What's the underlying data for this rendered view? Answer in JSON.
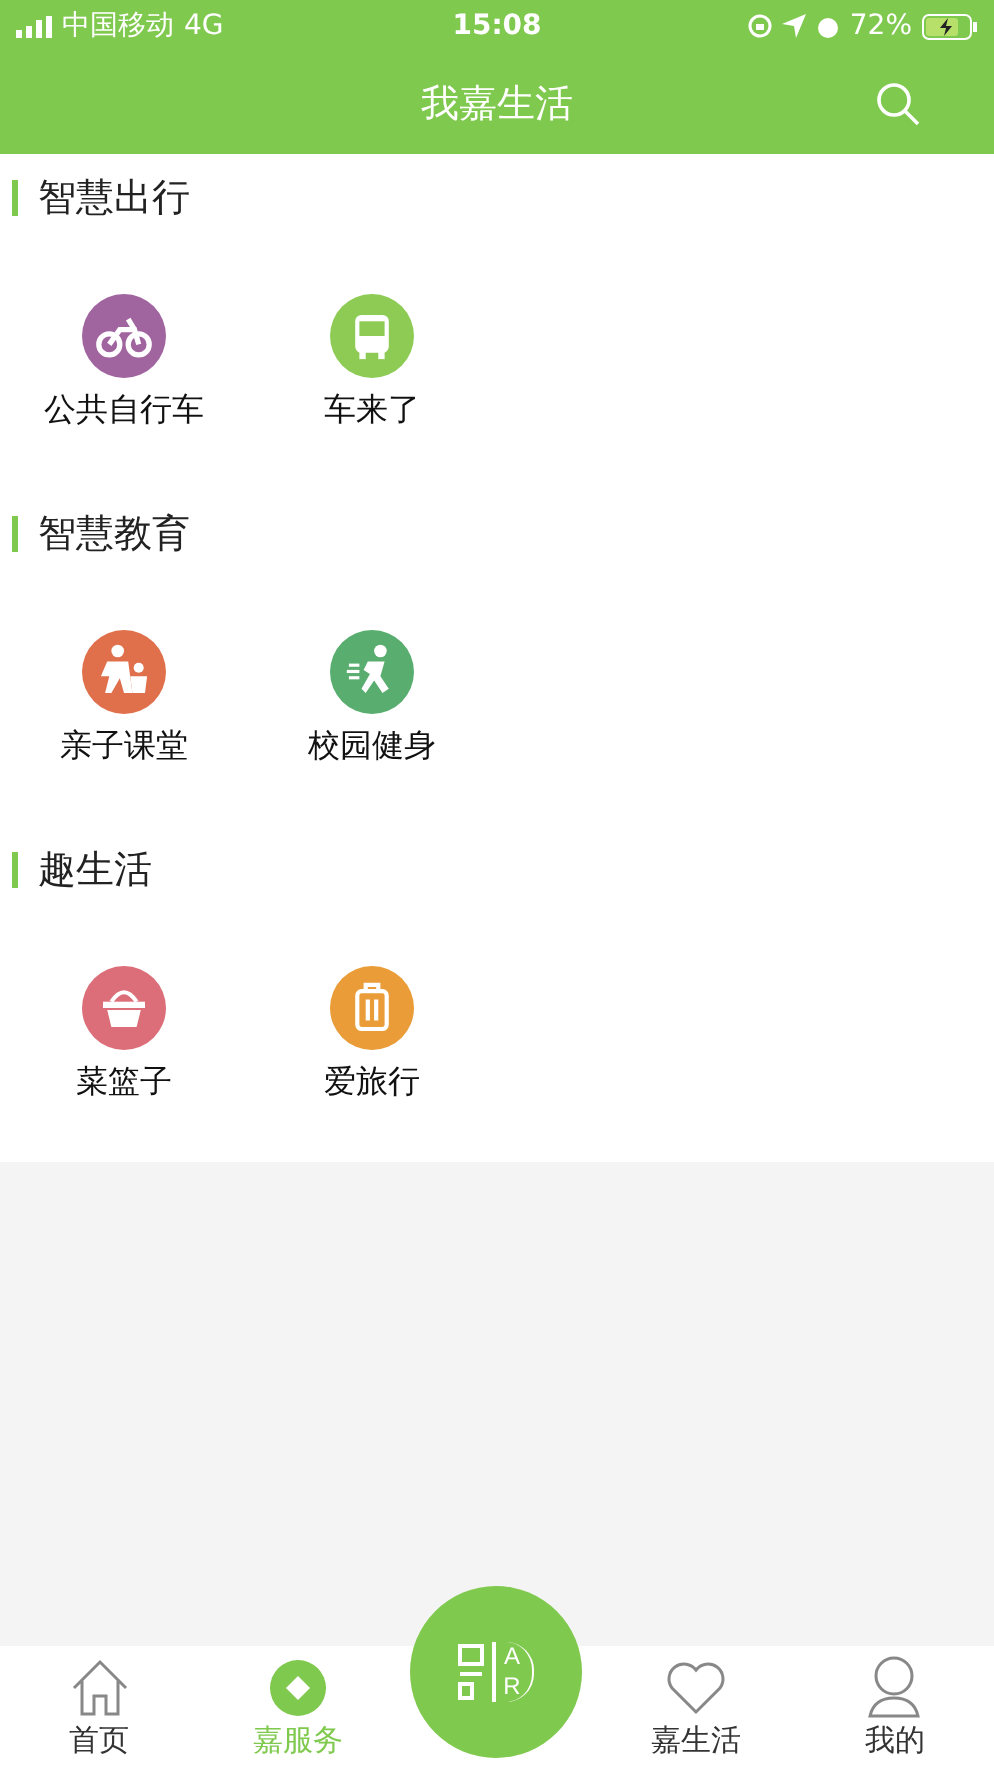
{
  "status_bar": {
    "carrier": "中国移动",
    "network": "4G",
    "time": "15:08",
    "battery": "72%"
  },
  "header": {
    "title": "我嘉生活"
  },
  "sections": [
    {
      "title": "智慧出行",
      "items": [
        {
          "label": "公共自行车",
          "kind": "bike",
          "color": "#a0649f"
        },
        {
          "label": "车来了",
          "kind": "bus",
          "color": "#8dcb55"
        }
      ]
    },
    {
      "title": "智慧教育",
      "items": [
        {
          "label": "亲子课堂",
          "kind": "family",
          "color": "#e0704c"
        },
        {
          "label": "校园健身",
          "kind": "runner",
          "color": "#58ad6f"
        }
      ]
    },
    {
      "title": "趣生活",
      "items": [
        {
          "label": "菜篮子",
          "kind": "basket",
          "color": "#dc6e79"
        },
        {
          "label": "爱旅行",
          "kind": "luggage",
          "color": "#e99c37"
        }
      ]
    }
  ],
  "ar_button": {
    "letters": [
      "A",
      "R"
    ]
  },
  "tabs": [
    {
      "label": "首页",
      "kind": "home",
      "selected": false
    },
    {
      "label": "嘉服务",
      "kind": "service",
      "selected": true
    },
    {
      "label": "嘉生活",
      "kind": "heart",
      "selected": false
    },
    {
      "label": "我的",
      "kind": "person",
      "selected": false
    }
  ]
}
